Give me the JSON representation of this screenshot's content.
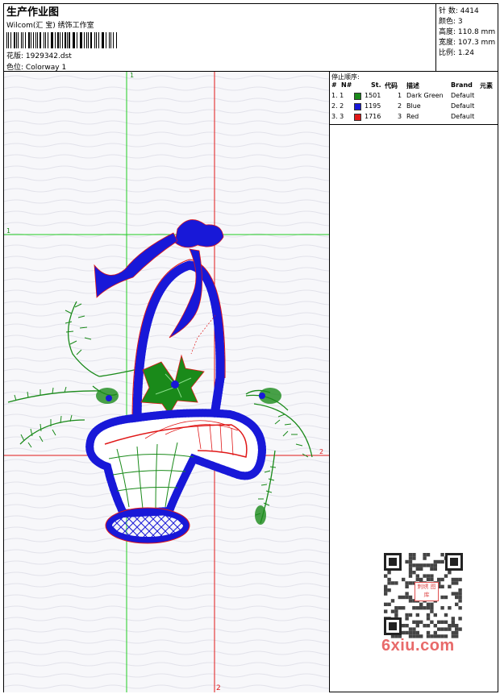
{
  "header": {
    "title": "生产作业图",
    "company": "Wilcom(汇 宝) 绣饰工作室",
    "file_label": "花版:",
    "file_name": "1929342.dst",
    "colorway_label": "色位:",
    "colorway_value": "Colorway 1"
  },
  "info": {
    "stitches_label": "针 数:",
    "stitches": "4414",
    "colors_label": "颜色:",
    "colors": "3",
    "height_label": "高度:",
    "height": "110.8 mm",
    "width_label": "宽度:",
    "width": "107.3 mm",
    "ratio_label": "比例:",
    "ratio": "1.24"
  },
  "stop_sequence": {
    "title": "停止顺序:",
    "columns": [
      "#",
      "N#",
      "St.",
      "代码",
      "描述",
      "Brand",
      "元素"
    ],
    "rows": [
      {
        "num": "1. 1",
        "color": "#1a8a1a",
        "st": "1501",
        "code": "1",
        "desc": "Dark Green",
        "brand": "Default"
      },
      {
        "num": "2. 2",
        "color": "#1818d8",
        "st": "1195",
        "code": "2",
        "desc": "Blue",
        "brand": "Default"
      },
      {
        "num": "3. 3",
        "color": "#e01818",
        "st": "1716",
        "code": "3",
        "desc": "Red",
        "brand": "Default"
      }
    ]
  },
  "axes": {
    "green_v": "1",
    "green_h": "1",
    "red_h": "2",
    "red_v": "2"
  },
  "watermark": {
    "text": "6xiu.com",
    "mark": "刺绣 图库"
  },
  "colors": {
    "green": "#1a8a1a",
    "blue": "#1818d8",
    "red": "#e01818",
    "grid": "#22cc22"
  }
}
